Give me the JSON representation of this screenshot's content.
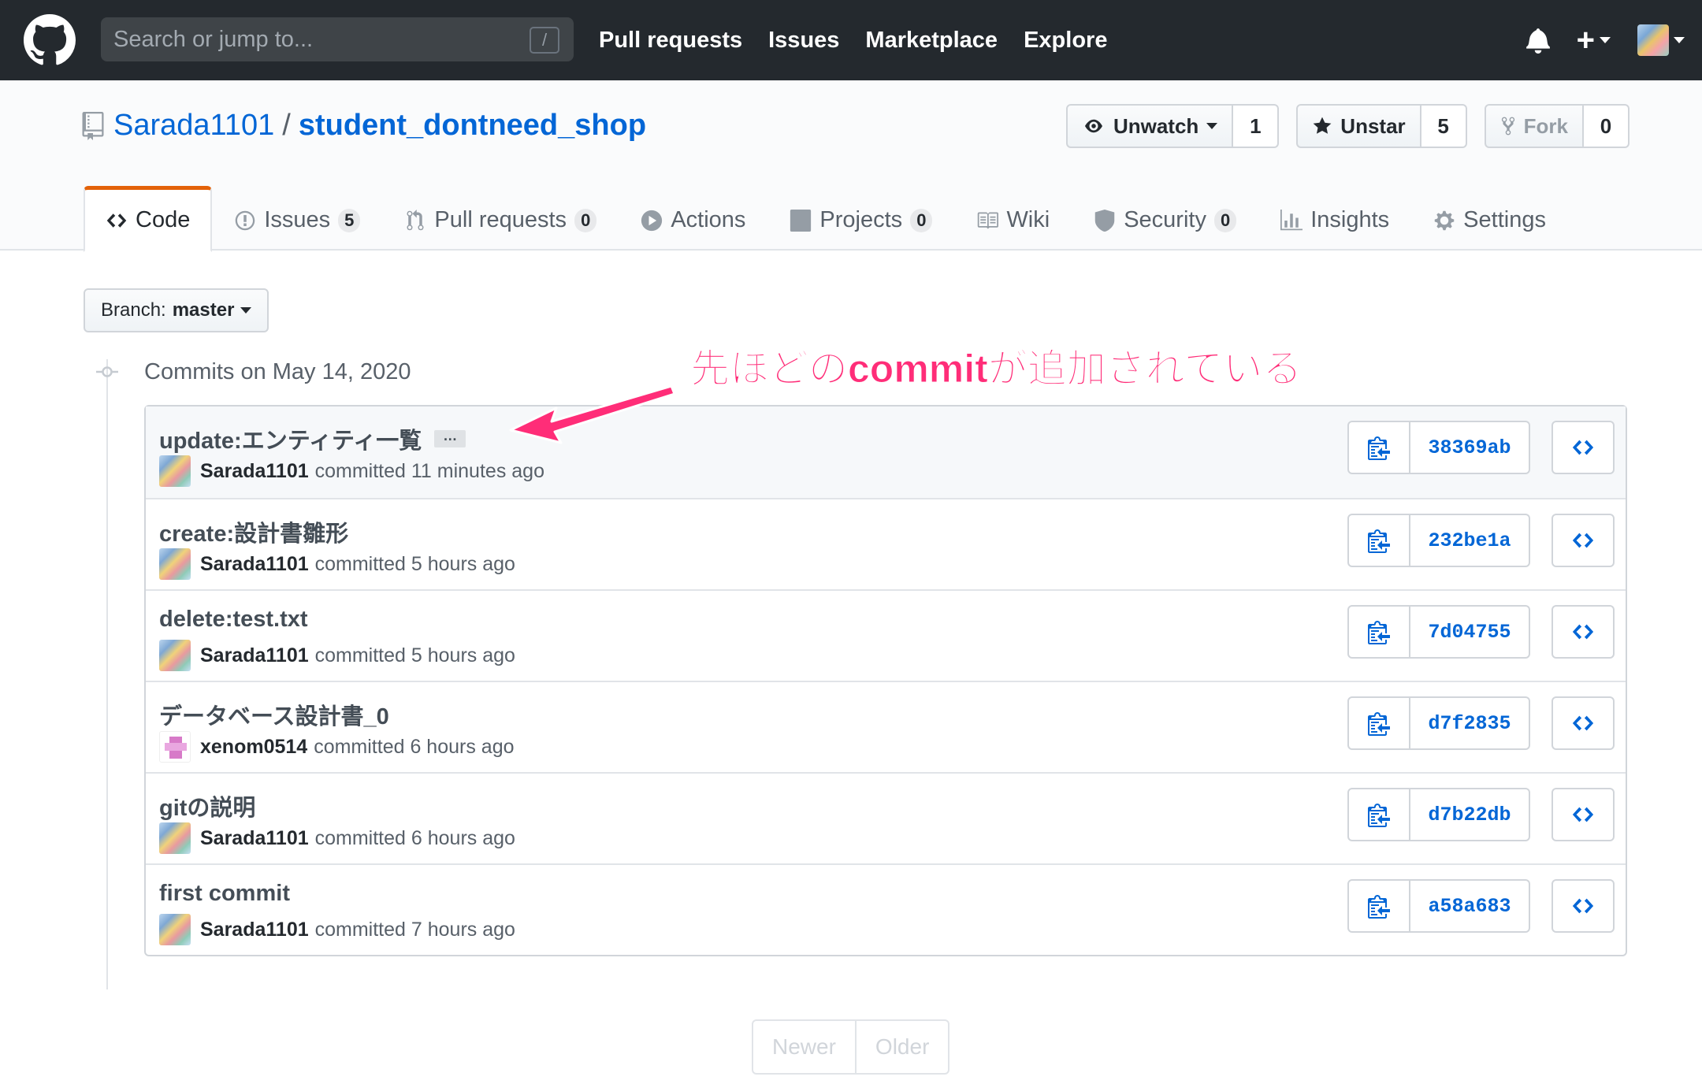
{
  "header": {
    "search_placeholder": "Search or jump to...",
    "search_shortcut": "/",
    "nav": [
      "Pull requests",
      "Issues",
      "Marketplace",
      "Explore"
    ],
    "plus_label": "+"
  },
  "repo": {
    "owner": "Sarada1101",
    "separator": "/",
    "name": "student_dontneed_shop",
    "watch_label": "Unwatch",
    "watch_count": "1",
    "star_label": "Unstar",
    "star_count": "5",
    "fork_label": "Fork",
    "fork_count": "0"
  },
  "tabs": [
    {
      "label": "Code",
      "counter": null,
      "icon": "code-icon",
      "selected": true
    },
    {
      "label": "Issues",
      "counter": "5",
      "icon": "issue-icon"
    },
    {
      "label": "Pull requests",
      "counter": "0",
      "icon": "pull-request-icon"
    },
    {
      "label": "Actions",
      "counter": null,
      "icon": "play-icon"
    },
    {
      "label": "Projects",
      "counter": "0",
      "icon": "project-icon"
    },
    {
      "label": "Wiki",
      "counter": null,
      "icon": "book-icon"
    },
    {
      "label": "Security",
      "counter": "0",
      "icon": "shield-icon"
    },
    {
      "label": "Insights",
      "counter": null,
      "icon": "graph-icon"
    },
    {
      "label": "Settings",
      "counter": null,
      "icon": "gear-icon"
    }
  ],
  "branch": {
    "prefix": "Branch:",
    "name": "master"
  },
  "commits_group": {
    "title": "Commits on May 14, 2020"
  },
  "commits": [
    {
      "message": "update:エンティティ一覧",
      "author": "Sarada1101",
      "time": "committed 11 minutes ago",
      "sha": "38369ab",
      "has_ellipsis": true,
      "avatar": "a"
    },
    {
      "message": "create:設計書雛形",
      "author": "Sarada1101",
      "time": "committed 5 hours ago",
      "sha": "232be1a",
      "avatar": "a"
    },
    {
      "message": "delete:test.txt",
      "author": "Sarada1101",
      "time": "committed 5 hours ago",
      "sha": "7d04755",
      "avatar": "a"
    },
    {
      "message": "データベース設計書_0",
      "author": "xenom0514",
      "time": "committed 6 hours ago",
      "sha": "d7f2835",
      "avatar": "b"
    },
    {
      "message": "gitの説明",
      "author": "Sarada1101",
      "time": "committed 6 hours ago",
      "sha": "d7b22db",
      "avatar": "a"
    },
    {
      "message": "first commit",
      "author": "Sarada1101",
      "time": "committed 7 hours ago",
      "sha": "a58a683",
      "avatar": "a"
    }
  ],
  "ellipsis_label": "…",
  "pagination": {
    "newer": "Newer",
    "older": "Older"
  },
  "annotation": {
    "text": "先ほどのcommitが追加されている",
    "color": "#ff2d78"
  },
  "colors": {
    "header_bg": "#24292e",
    "link": "#0366d6",
    "tab_accent": "#e36209"
  }
}
